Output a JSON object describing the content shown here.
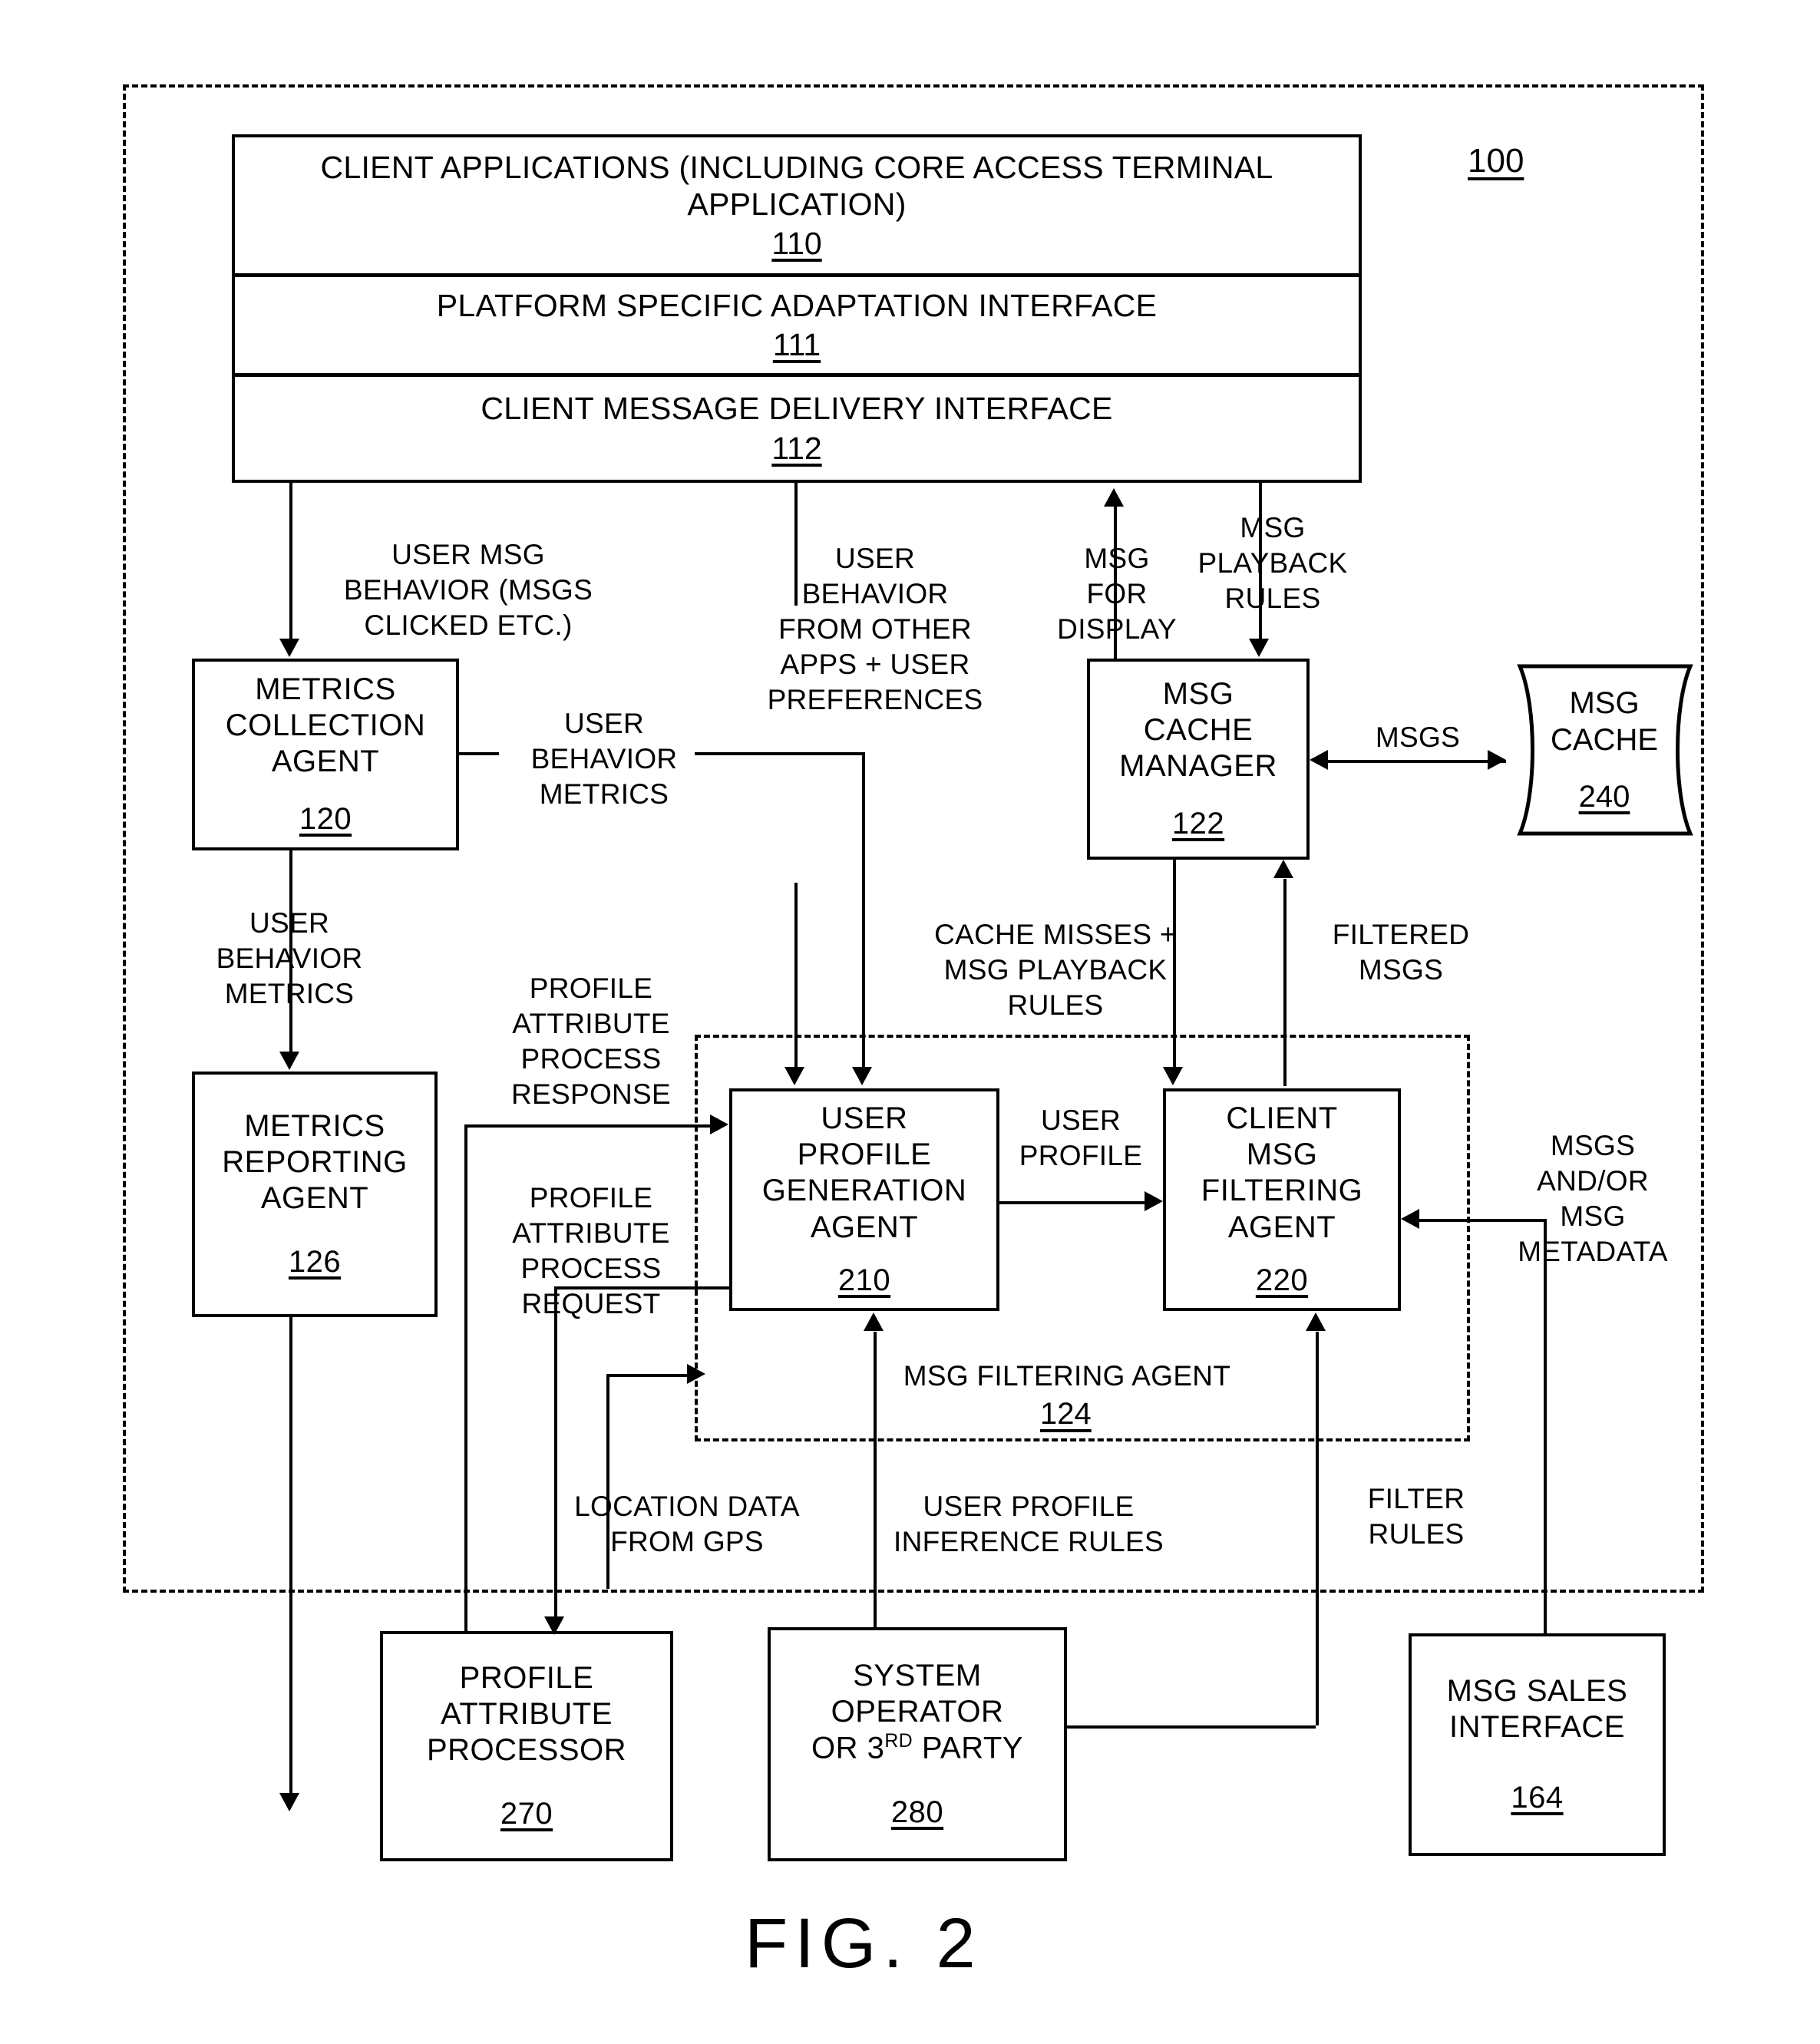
{
  "figure": {
    "caption": "FIG. 2",
    "system_ref": "100"
  },
  "client_stack": {
    "applications": {
      "title": "CLIENT APPLICATIONS (INCLUDING CORE ACCESS TERMINAL\nAPPLICATION)",
      "num": "110"
    },
    "adaptation": {
      "title": "PLATFORM SPECIFIC ADAPTATION INTERFACE",
      "num": "111"
    },
    "delivery": {
      "title": "CLIENT MESSAGE DELIVERY INTERFACE",
      "num": "112"
    }
  },
  "nodes": {
    "metrics_collection": {
      "title": "METRICS\nCOLLECTION\nAGENT",
      "num": "120"
    },
    "metrics_reporting": {
      "title": "METRICS\nREPORTING\nAGENT",
      "num": "126"
    },
    "msg_cache_manager": {
      "title": "MSG\nCACHE\nMANAGER",
      "num": "122"
    },
    "msg_cache": {
      "title": "MSG\nCACHE",
      "num": "240"
    },
    "user_profile_gen": {
      "title": "USER\nPROFILE\nGENERATION\nAGENT",
      "num": "210"
    },
    "client_msg_filter": {
      "title": "CLIENT\nMSG\nFILTERING\nAGENT",
      "num": "220"
    },
    "profile_attr_proc": {
      "title": "PROFILE\nATTRIBUTE\nPROCESSOR",
      "num": "270"
    },
    "system_operator": {
      "title_a": "SYSTEM\nOPERATOR\nOR 3",
      "title_sup": "RD",
      "title_b": " PARTY",
      "num": "280"
    },
    "msg_sales_interface": {
      "title": "MSG SALES\nINTERFACE",
      "num": "164"
    }
  },
  "regions": {
    "msg_filtering_agent": {
      "title": "MSG FILTERING AGENT",
      "num": "124"
    }
  },
  "edge_labels": {
    "user_msg_behavior": "USER MSG\nBEHAVIOR (MSGS\nCLICKED ETC.)",
    "user_behavior_other_apps": "USER\nBEHAVIOR\nFROM OTHER\nAPPS + USER\nPREFERENCES",
    "msg_for_display": "MSG\nFOR\nDISPLAY",
    "msg_playback_rules": "MSG\nPLAYBACK\nRULES",
    "user_behavior_metrics_h": "USER\nBEHAVIOR\nMETRICS",
    "user_behavior_metrics_v": "USER\nBEHAVIOR\nMETRICS",
    "msgs": "MSGS",
    "profile_attr_response": "PROFILE\nATTRIBUTE\nPROCESS\nRESPONSE",
    "profile_attr_request": "PROFILE\nATTRIBUTE\nPROCESS\nREQUEST",
    "cache_misses": "CACHE MISSES +\nMSG PLAYBACK\nRULES",
    "filtered_msgs": "FILTERED\nMSGS",
    "user_profile": "USER\nPROFILE",
    "msgs_and_or_metadata": "MSGS\nAND/OR\nMSG\nMETADATA",
    "location_data_gps": "LOCATION DATA\nFROM GPS",
    "user_profile_inference": "USER PROFILE\nINFERENCE RULES",
    "filter_rules": "FILTER\nRULES"
  },
  "colors": {
    "ink": "#000000",
    "paper": "#ffffff"
  }
}
